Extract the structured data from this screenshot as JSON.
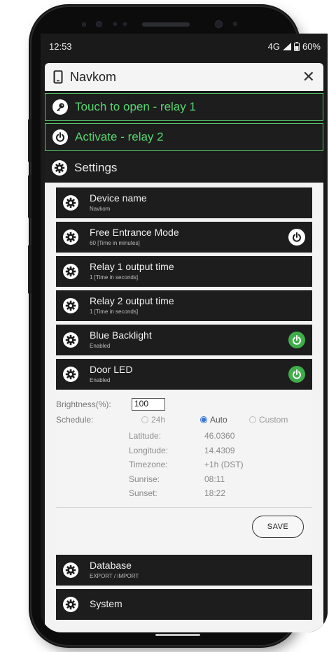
{
  "status_bar": {
    "time": "12:53",
    "network": "4G",
    "battery": "60%"
  },
  "header": {
    "title": "Navkom"
  },
  "menu": [
    {
      "label": "Touch to open - relay 1",
      "icon": "key-icon"
    },
    {
      "label": "Activate - relay 2",
      "icon": "power-icon"
    },
    {
      "label": "Settings",
      "icon": "gear-icon"
    }
  ],
  "settings": [
    {
      "name": "Device name",
      "sub": "Navkom"
    },
    {
      "name": "Free Entrance Mode",
      "sub": "60 [Time in minutes]"
    },
    {
      "name": "Relay 1 output time",
      "sub": "1 [Time in seconds]"
    },
    {
      "name": "Relay 2 output time",
      "sub": "1 [Time in seconds]"
    },
    {
      "name": "Blue Backlight",
      "sub": "Enabled"
    },
    {
      "name": "Door LED",
      "sub": "Enabled"
    }
  ],
  "door_led": {
    "brightness_label": "Brightness(%):",
    "brightness_value": "100",
    "schedule_label": "Schedule:",
    "schedule_options": [
      "24h",
      "Auto",
      "Custom"
    ],
    "schedule_selected": "Auto",
    "info": [
      {
        "label": "Latitude:",
        "value": "46.0360"
      },
      {
        "label": "Longitude:",
        "value": "14.4309"
      },
      {
        "label": "Timezone:",
        "value": "+1h (DST)"
      },
      {
        "label": "Sunrise:",
        "value": "08:11"
      },
      {
        "label": "Sunset:",
        "value": "18:22"
      }
    ],
    "save_label": "SAVE"
  },
  "lower_settings": [
    {
      "name": "Database",
      "sub": "EXPORT / IMPORT"
    },
    {
      "name": "System",
      "sub": ""
    }
  ],
  "colors": {
    "accent_green": "#57d46f",
    "toggle_green": "#3fae4a",
    "radio_blue": "#3a78d6"
  }
}
